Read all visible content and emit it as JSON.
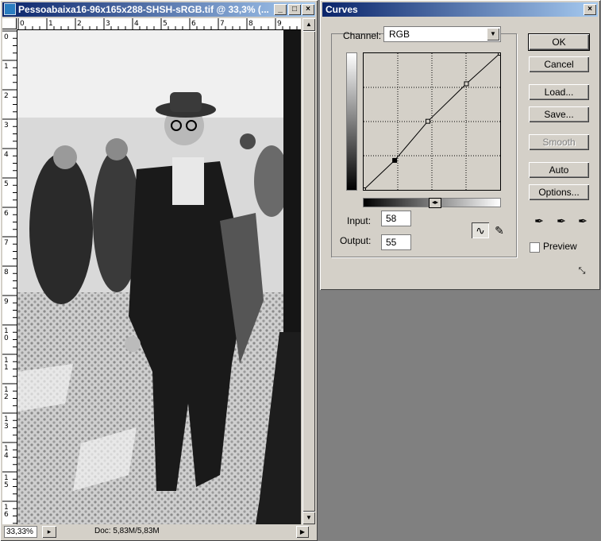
{
  "document": {
    "title": "Pessoabaixa16-96x165x288-SHSH-sRGB.tif @ 33,3% (...",
    "zoom": "33,33%",
    "doc_size": "Doc: 5,83M/5,83M",
    "ruler_top": [
      "0",
      "1",
      "2",
      "3",
      "4",
      "5",
      "6",
      "7",
      "8",
      "9"
    ],
    "ruler_left": [
      "0",
      "1",
      "2",
      "3",
      "4",
      "5",
      "6",
      "7",
      "8",
      "9",
      "10",
      "11",
      "12",
      "13",
      "14",
      "15",
      "16"
    ]
  },
  "curves": {
    "title": "Curves",
    "channel_label": "Channel:",
    "channel_value": "RGB",
    "input_label": "Input:",
    "input_value": "58",
    "output_label": "Output:",
    "output_value": "55",
    "buttons": {
      "ok": "OK",
      "cancel": "Cancel",
      "load": "Load...",
      "save": "Save...",
      "smooth": "Smooth",
      "auto": "Auto",
      "options": "Options..."
    },
    "preview_label": "Preview",
    "preview_checked": false,
    "curve_points": [
      [
        0,
        0
      ],
      [
        58,
        55
      ],
      [
        120,
        128
      ],
      [
        192,
        198
      ],
      [
        255,
        255
      ]
    ],
    "selected_point": 1
  }
}
